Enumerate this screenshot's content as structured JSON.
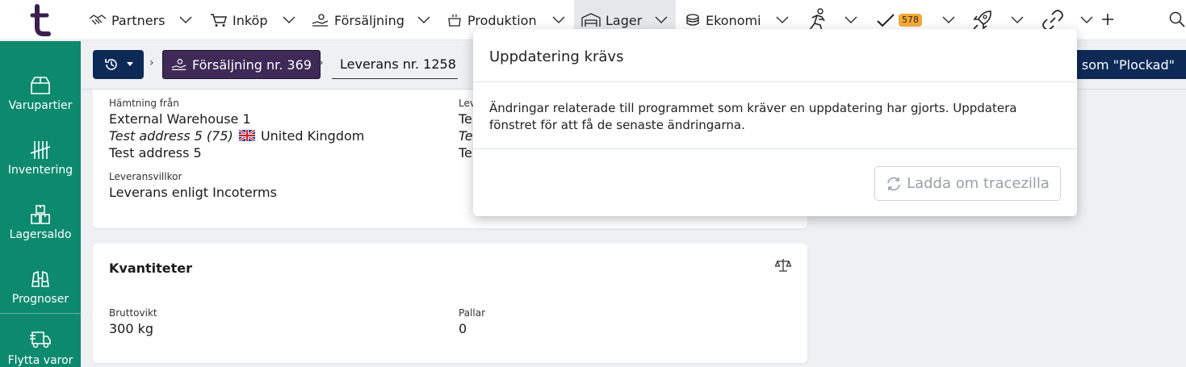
{
  "nav": {
    "items": [
      {
        "label": "Partners"
      },
      {
        "label": "Inköp"
      },
      {
        "label": "Försäljning"
      },
      {
        "label": "Produktion"
      },
      {
        "label": "Lager"
      },
      {
        "label": "Ekonomi"
      }
    ],
    "tasks_badge": "578",
    "active_color": "#e6e8eb"
  },
  "sidebar": {
    "items": [
      {
        "label": "Varupartier",
        "icon": "box-icon"
      },
      {
        "label": "Inventering",
        "icon": "tally-icon"
      },
      {
        "label": "Lagersaldo",
        "icon": "stacked-boxes-icon"
      },
      {
        "label": "Prognoser",
        "icon": "binoculars-icon"
      },
      {
        "label": "Flytta varor",
        "icon": "delivery-truck-icon"
      }
    ],
    "color": "#0d8a6e"
  },
  "breadcrumb": {
    "sale": "Försäljning nr. 369",
    "delivery": "Leverans nr. 1258",
    "picked_button": "a som \"Plockad\""
  },
  "delivery_card": {
    "pickup_label": "Hämtning från",
    "pickup_warehouse": "External Warehouse 1",
    "pickup_address_italic": "Test address 5 (75)",
    "pickup_country": "United Kingdom",
    "pickup_address": "Test address 5",
    "delivery_label": "Lev",
    "delivery_line1": "Te",
    "delivery_line2": "Te",
    "delivery_line3": "Te",
    "terms_label": "Leveransvillkor",
    "terms_value": "Leverans enligt Incoterms"
  },
  "quantities_card": {
    "title": "Kvantiteter",
    "gross_label": "Bruttovikt",
    "gross_value": "300 kg",
    "pallets_label": "Pallar",
    "pallets_value": "0"
  },
  "modal": {
    "title": "Uppdatering krävs",
    "body": "Ändringar relaterade till programmet som kräver en uppdatering har gjorts. Uppdatera fönstret för att få de senaste ändringarna.",
    "reload_button": "Ladda om tracezilla"
  },
  "colors": {
    "primary_dark": "#0d2a57",
    "sale_purple": "#3f2a57",
    "badge": "#f2a93b"
  }
}
